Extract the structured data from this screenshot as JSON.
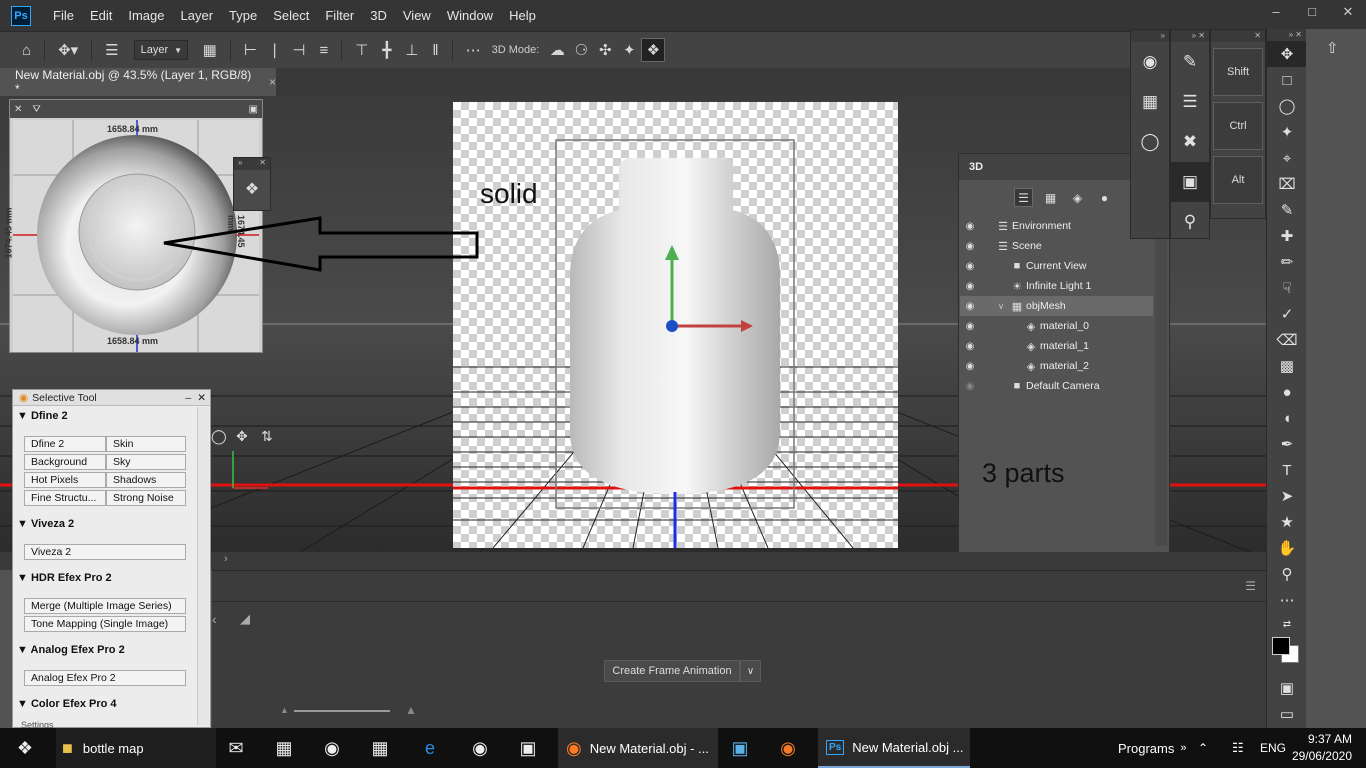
{
  "menubar": {
    "logo": "Ps",
    "items": [
      "File",
      "Edit",
      "Image",
      "Layer",
      "Type",
      "Select",
      "Filter",
      "3D",
      "View",
      "Window",
      "Help"
    ]
  },
  "options": {
    "layer_select": "Layer",
    "mode_label": "3D Mode:"
  },
  "document": {
    "tab_title": "New Material.obj @ 43.5% (Layer 1, RGB/8) *",
    "close": "×"
  },
  "annotations": {
    "solid": "solid",
    "parts": "3 parts"
  },
  "navigator": {
    "top_dim": "1658.84 mm",
    "bottom_dim": "1658.84 mm",
    "left_dim": "1674.45 mm",
    "right_dim": "1674.45 mm"
  },
  "panel3d": {
    "title": "3D",
    "rows": [
      {
        "label": "Environment",
        "icon": "environment-icon"
      },
      {
        "label": "Scene",
        "icon": "scene-icon"
      },
      {
        "label": "Current View",
        "icon": "camera-icon"
      },
      {
        "label": "Infinite Light 1",
        "icon": "light-icon"
      },
      {
        "label": "objMesh",
        "icon": "mesh-icon"
      },
      {
        "label": "material_0",
        "icon": "material-icon"
      },
      {
        "label": "material_1",
        "icon": "material-icon"
      },
      {
        "label": "material_2",
        "icon": "material-icon"
      },
      {
        "label": "Default Camera",
        "icon": "camera-icon"
      }
    ]
  },
  "keys": {
    "shift": "Shift",
    "ctrl": "Ctrl",
    "alt": "Alt"
  },
  "timeline": {
    "create_button": "Create Frame Animation"
  },
  "selective": {
    "title": "Selective Tool",
    "sections": [
      {
        "title": "Dfine 2",
        "buttons": [
          "Dfine 2",
          "Skin",
          "Background",
          "Sky",
          "Hot Pixels",
          "Shadows",
          "Fine Structu...",
          "Strong Noise"
        ]
      },
      {
        "title": "Viveza 2",
        "buttons": [
          "Viveza 2"
        ]
      },
      {
        "title": "HDR Efex Pro 2",
        "buttons": [
          "Merge (Multiple Image Series)",
          "Tone Mapping (Single Image)"
        ]
      },
      {
        "title": "Analog Efex Pro 2",
        "buttons": [
          "Analog Efex Pro 2"
        ]
      },
      {
        "title": "Color Efex Pro 4",
        "buttons": []
      }
    ],
    "footer": "Settings"
  },
  "taskbar": {
    "folder": "bottle map",
    "firefox": "New Material.obj - ...",
    "photoshop": "New Material.obj ...",
    "programs": "Programs",
    "lang": "ENG",
    "time": "9:37 AM",
    "date": "29/06/2020"
  }
}
